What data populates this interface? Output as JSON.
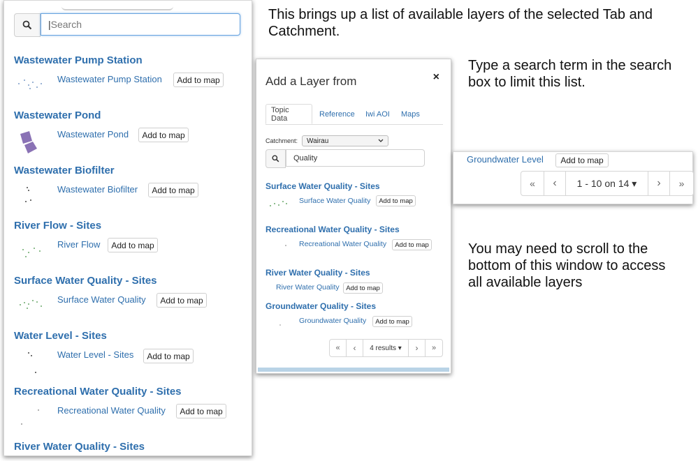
{
  "left_panel": {
    "search": {
      "placeholder": "Search"
    },
    "groups": [
      {
        "title": "Wastewater Pump Station",
        "layer": "Wastewater Pump Station",
        "button": "Add to map"
      },
      {
        "title": "Wastewater Pond",
        "layer": "Wastewater Pond",
        "button": "Add to map"
      },
      {
        "title": "Wastewater Biofilter",
        "layer": "Wastewater Biofilter",
        "button": "Add to map"
      },
      {
        "title": "River Flow - Sites",
        "layer": "River Flow",
        "button": "Add to map"
      },
      {
        "title": "Surface Water Quality - Sites",
        "layer": "Surface Water Quality",
        "button": "Add to map"
      },
      {
        "title": "Water Level - Sites",
        "layer": "Water Level - Sites",
        "button": "Add to map"
      },
      {
        "title": "Recreational Water Quality - Sites",
        "layer": "Recreational Water Quality",
        "button": "Add to map"
      },
      {
        "title": "River Water Quality - Sites"
      }
    ]
  },
  "annotations": {
    "note1": "This brings up a list of available layers of the selected Tab and Catchment.",
    "note2": "Type a search term in the search box to limit this list.",
    "note3": "You may need to scroll to the bottom of this window to access all available layers"
  },
  "dialog": {
    "title": "Add a Layer from",
    "close": "×",
    "tabs": [
      "Topic Data",
      "Reference",
      "Iwi AOI",
      "Maps"
    ],
    "catchment_label": "Catchment:",
    "catchment_value": "Wairau",
    "search_value": "Quality",
    "groups": [
      {
        "title": "Surface Water Quality - Sites",
        "layer": "Surface Water Quality",
        "button": "Add to map"
      },
      {
        "title": "Recreational Water Quality - Sites",
        "layer": "Recreational Water Quality",
        "button": "Add to map"
      },
      {
        "title": "River Water Quality - Sites",
        "layer": "River Water Quality",
        "button": "Add to map"
      },
      {
        "title": "Groundwater Quality - Sites",
        "layer": "Groundwater Quality",
        "button": "Add to map"
      }
    ],
    "pager": {
      "first": "«",
      "prev": "‹",
      "status": "4 results ▾",
      "next": "›",
      "last": "»"
    }
  },
  "snippet": {
    "layer": "Groundwater Level",
    "button": "Add to map",
    "pager": {
      "first": "«",
      "prev": "‹",
      "status": "1 - 10 on 14 ▾",
      "next": "›",
      "last": "»"
    }
  },
  "colors": {
    "link": "#2f6fad",
    "focus": "#66a3e0",
    "pond": "#8a72b5"
  },
  "icons": {
    "search": "magnifier-icon",
    "close": "close-icon"
  }
}
